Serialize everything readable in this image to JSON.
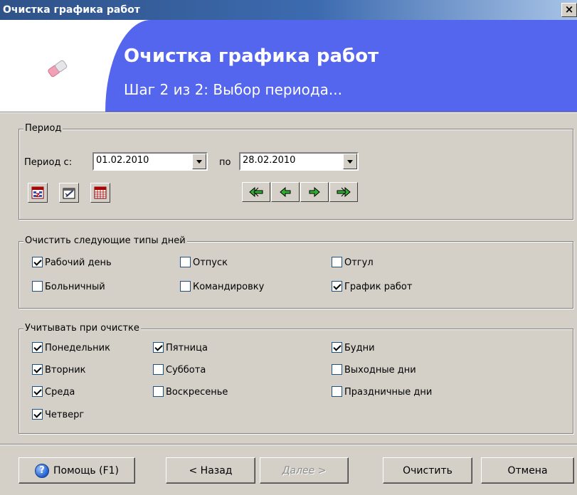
{
  "window": {
    "title": "Очистка графика работ",
    "close_glyph": "×"
  },
  "header": {
    "title": "Очистка графика работ",
    "subtitle": "Шаг 2 из 2: Выбор периода...",
    "icon": "eraser-icon",
    "accent_color": "#5566ee"
  },
  "period": {
    "legend": "Период",
    "from_label": "Период с:",
    "from_value": "01.02.2010",
    "to_label": "по",
    "to_value": "28.02.2010",
    "tools": [
      "calendar-day-icon",
      "calendar-edit-icon",
      "calendar-month-icon"
    ],
    "nav": [
      "double-left-arrow-icon",
      "left-arrow-icon",
      "right-arrow-icon",
      "double-right-arrow-icon"
    ]
  },
  "day_types": {
    "legend": "Очистить следующие типы дней",
    "items": [
      {
        "label": "Рабочий день",
        "checked": true
      },
      {
        "label": "Отпуск",
        "checked": false
      },
      {
        "label": "Отгул",
        "checked": false
      },
      {
        "label": "Больничный",
        "checked": false
      },
      {
        "label": "Командировку",
        "checked": false
      },
      {
        "label": "График работ",
        "checked": true
      }
    ]
  },
  "consider": {
    "legend": "Учитывать при очистке",
    "items": [
      {
        "label": "Понедельник",
        "checked": true
      },
      {
        "label": "Вторник",
        "checked": true
      },
      {
        "label": "Среда",
        "checked": true
      },
      {
        "label": "Четверг",
        "checked": true
      },
      {
        "label": "Пятница",
        "checked": true
      },
      {
        "label": "Суббота",
        "checked": false
      },
      {
        "label": "Воскресенье",
        "checked": false
      },
      {
        "label": "Будни",
        "checked": true
      },
      {
        "label": "Выходные дни",
        "checked": false
      },
      {
        "label": "Праздничные дни",
        "checked": false
      }
    ]
  },
  "buttons": {
    "help": "Помощь (F1)",
    "back": "< Назад",
    "next": "Далее >",
    "clear": "Очистить",
    "cancel": "Отмена"
  }
}
